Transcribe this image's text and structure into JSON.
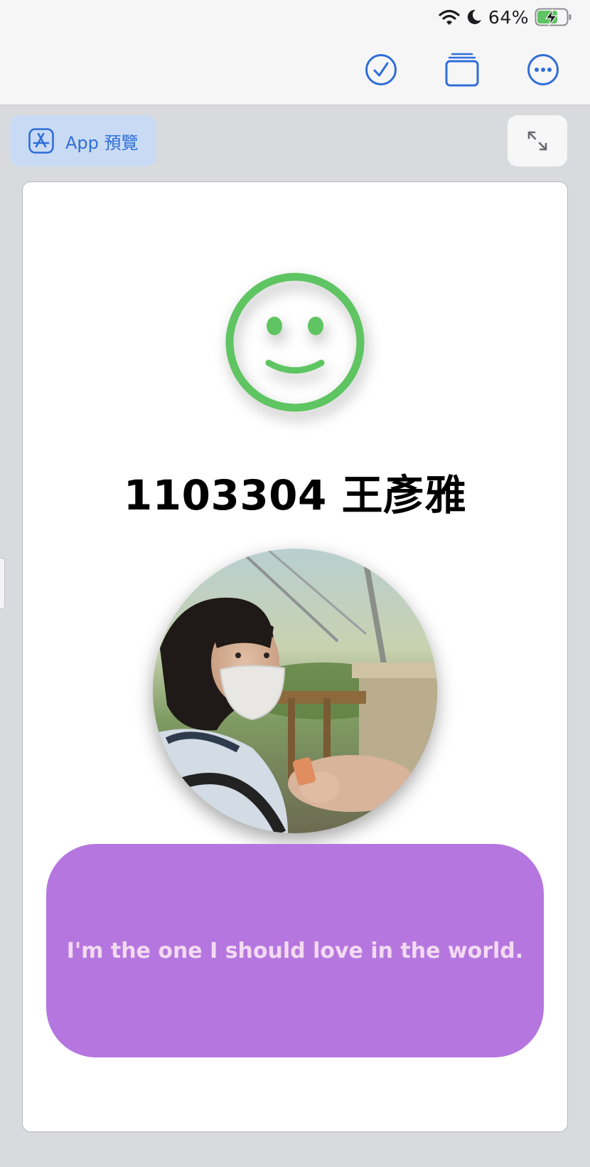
{
  "status_bar": {
    "battery_percent": "64%",
    "icons": [
      "wifi-icon",
      "moon-icon",
      "battery-charging-icon"
    ]
  },
  "toolbar": {
    "icons": [
      "checkmark-circle-icon",
      "stack-icon",
      "more-options-icon"
    ],
    "accent": "#2f6ed8"
  },
  "preview_button": {
    "label": "App 預覽",
    "icon": "app-store-icon"
  },
  "expand_button": {
    "icon": "expand-arrows-icon"
  },
  "card": {
    "emoji": "smiley-face-icon",
    "emoji_color": "#5fc462",
    "name": "1103304 王彥雅",
    "photo": "profile-photo",
    "quote": "I'm the one I should love in the world.",
    "quote_bg": "#b577df",
    "quote_text_color": "#f3daf2"
  }
}
